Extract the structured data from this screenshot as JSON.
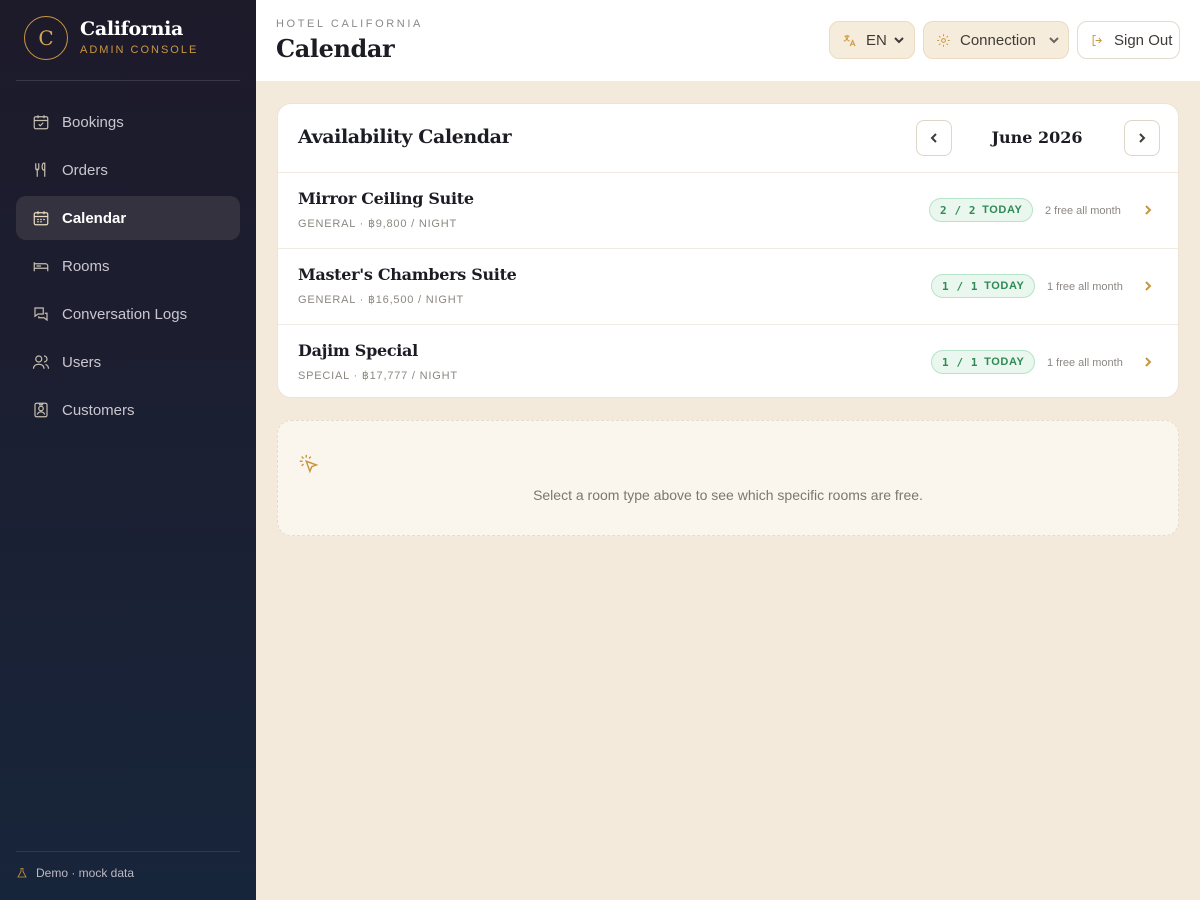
{
  "brand": {
    "mark": "C",
    "name": "California",
    "subtitle": "ADMIN CONSOLE"
  },
  "sidebar": {
    "items": [
      {
        "label": "Bookings",
        "icon": "calendar-check-icon",
        "active": false
      },
      {
        "label": "Orders",
        "icon": "utensils-icon",
        "active": false
      },
      {
        "label": "Calendar",
        "icon": "calendar-icon",
        "active": true
      },
      {
        "label": "Rooms",
        "icon": "bed-icon",
        "active": false
      },
      {
        "label": "Conversation Logs",
        "icon": "chat-bubbles-icon",
        "active": false
      },
      {
        "label": "Users",
        "icon": "users-icon",
        "active": false
      },
      {
        "label": "Customers",
        "icon": "contact-card-icon",
        "active": false
      }
    ],
    "footer": "Demo · mock data"
  },
  "header": {
    "eyebrow": "HOTEL CALIFORNIA",
    "title": "Calendar",
    "language": "EN",
    "connection": "Connection",
    "sign_out": "Sign Out"
  },
  "calendar": {
    "title": "Availability Calendar",
    "month": "June 2026",
    "rooms": [
      {
        "name": "Mirror Ceiling Suite",
        "meta": "GENERAL · ฿9,800 / NIGHT",
        "count": "2 / 2",
        "today": "TODAY",
        "free": "2 free all month"
      },
      {
        "name": "Master's Chambers Suite",
        "meta": "GENERAL · ฿16,500 / NIGHT",
        "count": "1 / 1",
        "today": "TODAY",
        "free": "1 free all month"
      },
      {
        "name": "Dajim Special",
        "meta": "SPECIAL · ฿17,777 / NIGHT",
        "count": "1 / 1",
        "today": "TODAY",
        "free": "1 free all month"
      }
    ]
  },
  "empty_state": {
    "text": "Select a room type above to see which specific rooms are free."
  },
  "colors": {
    "accent": "#c9973f",
    "sidebar": "#1d1a2a",
    "background": "#f3eadb",
    "success": "#2f8a55"
  }
}
